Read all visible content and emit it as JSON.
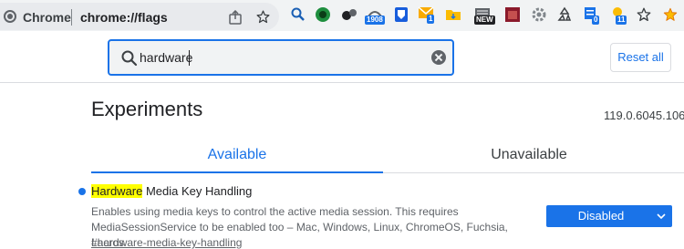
{
  "browser": {
    "site_label": "Chrome",
    "url": "chrome://flags",
    "icons": [
      "chrome-logo",
      "share-icon",
      "star-icon"
    ]
  },
  "extensions": [
    {
      "name": "magnifier-extension-icon",
      "badge": ""
    },
    {
      "name": "green-circle-extension-icon",
      "badge": ""
    },
    {
      "name": "spheres-extension-icon",
      "badge": ""
    },
    {
      "name": "counter-extension-icon",
      "badge": "1908"
    },
    {
      "name": "bitwarden-extension-icon",
      "badge": ""
    },
    {
      "name": "mail-extension-icon",
      "badge": "1"
    },
    {
      "name": "folder-extension-icon",
      "badge": ""
    },
    {
      "name": "news-extension-icon",
      "badge": "NEW"
    },
    {
      "name": "image-extension-icon",
      "badge": ""
    },
    {
      "name": "gear-extension-icon",
      "badge": ""
    },
    {
      "name": "recycle-extension-icon",
      "badge": ""
    },
    {
      "name": "notes-extension-icon",
      "badge": "0"
    },
    {
      "name": "bulb-extension-icon",
      "badge": "11"
    },
    {
      "name": "star-extension-icon",
      "badge": ""
    },
    {
      "name": "gold-star-icon",
      "badge": ""
    }
  ],
  "search": {
    "value": "hardware",
    "clear_icon": "clear-icon"
  },
  "reset_label": "Reset all",
  "page": {
    "title": "Experiments",
    "version": "119.0.6045.106"
  },
  "tabs": [
    {
      "label": "Available",
      "active": true
    },
    {
      "label": "Unavailable",
      "active": false
    }
  ],
  "experiment": {
    "title_highlight": "Hardware",
    "title_rest": " Media Key Handling",
    "description": "Enables using media keys to control the active media session. This requires MediaSessionService to be enabled too – Mac, Windows, Linux, ChromeOS, Fuchsia, Lacros",
    "link": "#hardware-media-key-handling",
    "select_value": "Disabled"
  },
  "colors": {
    "accent": "#1a73e8",
    "highlight": "#ffff00",
    "toolbar_bg": "#f1f3f4"
  }
}
